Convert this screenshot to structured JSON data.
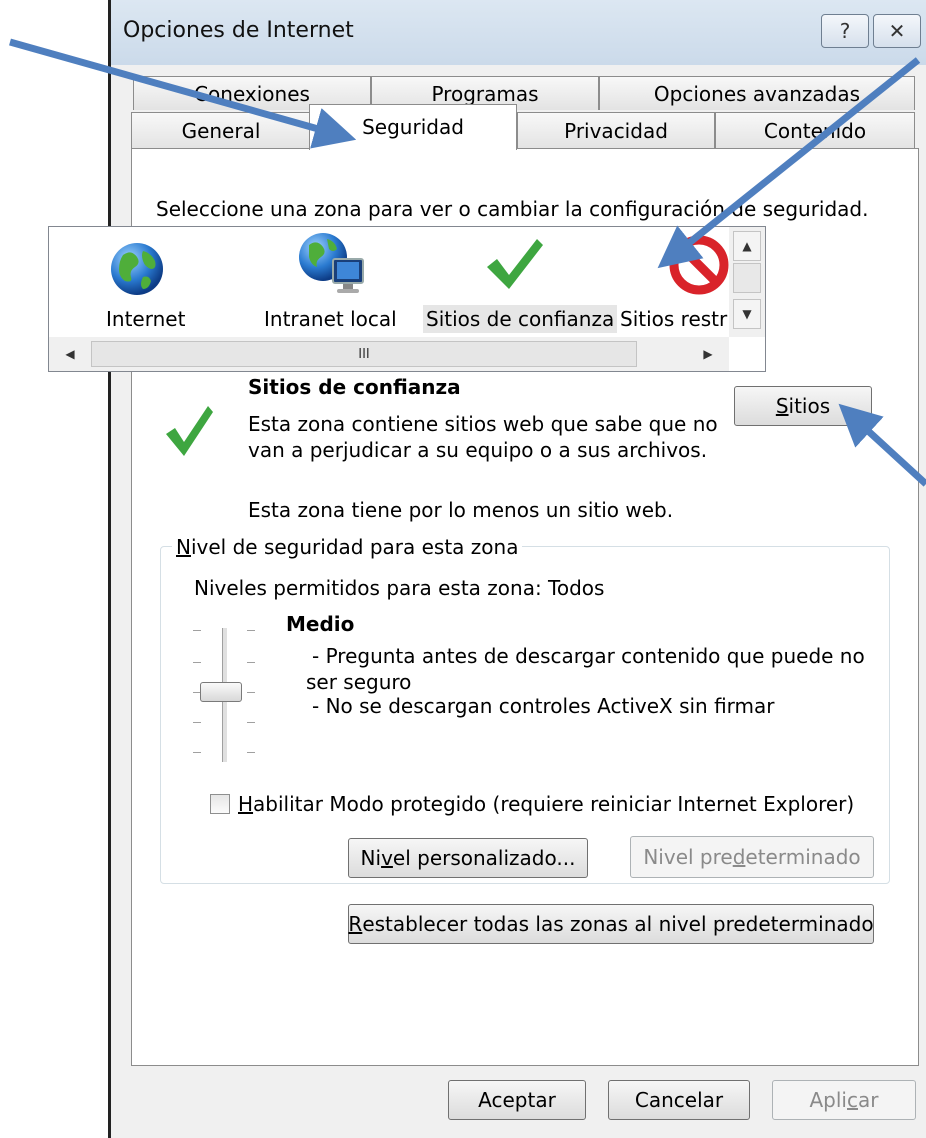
{
  "window": {
    "title": "Opciones de Internet",
    "help_glyph": "?",
    "close_glyph": "✕"
  },
  "tabs": {
    "row_back": [
      "Conexiones",
      "Programas",
      "Opciones avanzadas"
    ],
    "row_front": [
      "General",
      "Seguridad",
      "Privacidad",
      "Contenido"
    ],
    "active": "Seguridad"
  },
  "zone_select": {
    "prompt": "Seleccione una zona para ver o cambiar la configuración de seguridad.",
    "zones": [
      {
        "label": "Internet",
        "icon": "globe-icon"
      },
      {
        "label": "Intranet local",
        "icon": "intranet-globe-monitor-icon"
      },
      {
        "label": "Sitios de confianza",
        "icon": "green-checkmark-icon",
        "selected": true
      },
      {
        "label": "Sitios restri",
        "icon": "red-prohibition-icon"
      }
    ],
    "hscroll_grip": "III"
  },
  "zone_info": {
    "title": "Sitios de confianza",
    "description_line1": "Esta zona contiene sitios web que sabe que no",
    "description_line2": "van a perjudicar a su equipo o a sus archivos.",
    "count_note": "Esta zona tiene por lo menos un sitio web.",
    "sites_button": {
      "accel": "S",
      "rest": "itios"
    }
  },
  "security_level": {
    "group_title": {
      "accel": "N",
      "rest": "ivel de seguridad para esta zona"
    },
    "allowed": "Niveles permitidos para esta zona: Todos",
    "level_name": "Medio",
    "bullet1_line1": "- Pregunta antes de descargar contenido que puede no",
    "bullet1_line2": "ser seguro",
    "bullet2": "- No se descargan controles ActiveX sin firmar",
    "slider_level": {
      "position": 3,
      "of": 5
    },
    "protected_mode": {
      "checked": false,
      "accel": "H",
      "rest": "abilitar Modo protegido (requiere reiniciar Internet Explorer)"
    },
    "custom_button": {
      "pre": "Ni",
      "accel": "v",
      "post": "el personalizado..."
    },
    "default_button": {
      "pre": "Nivel pre",
      "accel": "d",
      "post": "eterminado",
      "disabled": true
    }
  },
  "reset_all": {
    "accel": "R",
    "rest": "establecer todas las zonas al nivel predeterminado"
  },
  "footer": {
    "ok": "Aceptar",
    "cancel": "Cancelar",
    "apply": {
      "pre": "Apli",
      "accel": "c",
      "post": "ar",
      "disabled": true
    }
  },
  "colors": {
    "annotation_arrow": "#4f7fbf",
    "check_green": "#3ea640",
    "prohibit_red": "#d9232a"
  }
}
